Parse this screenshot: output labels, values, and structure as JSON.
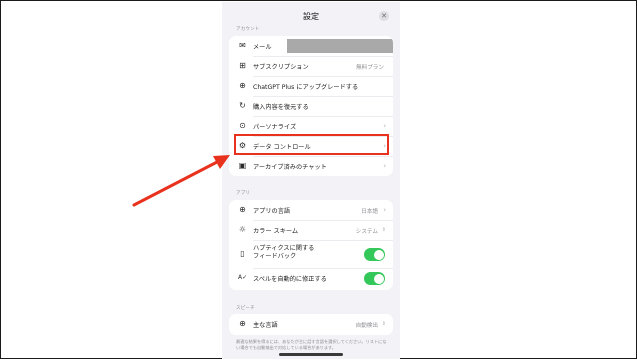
{
  "window": {
    "title": "設定"
  },
  "colors": {
    "accent_toggle": "#34c759",
    "highlight": "#e8321e",
    "background": "#f2f2f7"
  },
  "icons": {
    "close": "close-icon"
  },
  "sections": {
    "account": {
      "label": "アカウント",
      "items": [
        {
          "icon": "mail-icon",
          "label": "メール"
        },
        {
          "icon": "plus-square-icon",
          "label": "サブスクリプション",
          "value": "無料プラン"
        },
        {
          "icon": "upgrade-icon",
          "label": "ChatGPT Plus にアップグレードする"
        },
        {
          "icon": "restore-icon",
          "label": "購入内容を復元する"
        },
        {
          "icon": "personalize-icon",
          "label": "パーソナライズ"
        },
        {
          "icon": "data-controls-icon",
          "label": "データ コントロール"
        },
        {
          "icon": "archive-icon",
          "label": "アーカイブ済みのチャット"
        }
      ]
    },
    "app": {
      "label": "アプリ",
      "items": [
        {
          "icon": "globe-icon",
          "label": "アプリの言語",
          "value": "日本語"
        },
        {
          "icon": "sun-icon",
          "label": "カラー スキーム",
          "value": "システム"
        },
        {
          "icon": "haptics-icon",
          "label": "ハプティクスに関する\nフィードバック",
          "toggle": true
        },
        {
          "icon": "spellcheck-icon",
          "label": "スペルを自動的に修正する",
          "toggle": true
        }
      ]
    },
    "speech": {
      "label": "スピーチ",
      "items": [
        {
          "icon": "globe-icon",
          "label": "主な言語",
          "value": "自動検出"
        }
      ],
      "note": "最適な結果を得るには、あなたが主に話す言語を選択してください。リストにない場合でも自動検出で対応している場合があります。"
    }
  }
}
